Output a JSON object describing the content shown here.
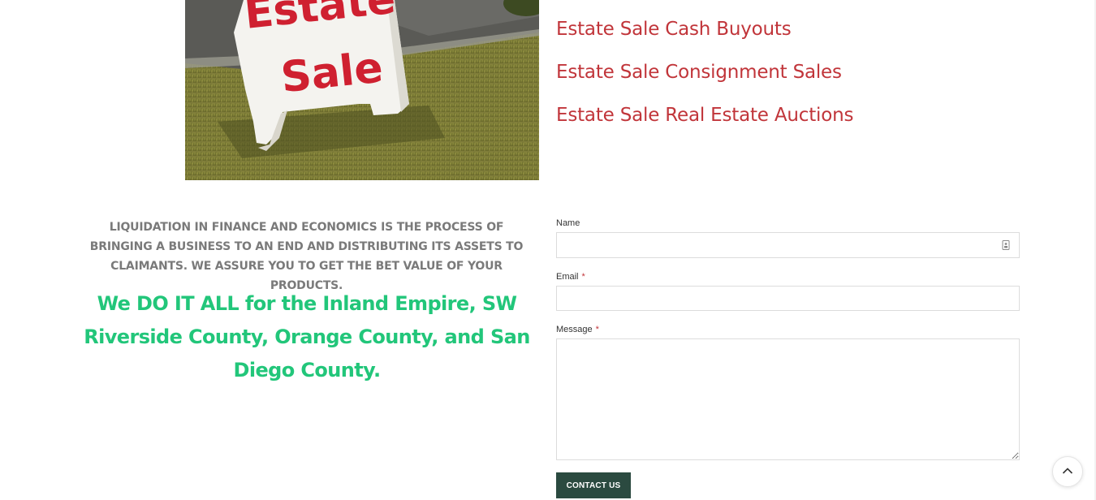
{
  "hero_image": {
    "sign_line1": "Estate",
    "sign_line2": "Sale"
  },
  "services": [
    "Estate Sale Cash Buyouts",
    "Estate Sale Consignment Sales",
    "Estate Sale Real Estate Auctions"
  ],
  "intro_text": "LIQUIDATION IN FINANCE AND ECONOMICS IS THE PROCESS OF BRINGING A BUSINESS TO AN END AND DISTRIBUTING ITS ASSETS TO CLAIMANTS. WE ASSURE YOU TO GET THE BET VALUE OF YOUR PRODUCTS.",
  "tagline": "We DO IT ALL for the Inland Empire, SW Riverside County, Orange County, and San Diego County.",
  "form": {
    "name_label": "Name",
    "name_value": "",
    "email_label": "Email",
    "email_value": "",
    "message_label": "Message",
    "message_value": "",
    "required_mark": "*",
    "submit_label": "CONTACT US"
  },
  "icons": {
    "name_field": "contact-card-icon",
    "scroll_top": "chevron-up-icon",
    "textarea_grip": "resize-grip-icon"
  },
  "colors": {
    "service_links": "#c1353a",
    "tagline": "#22c67a",
    "intro": "#7a7a7a",
    "submit_bg": "#2b4a40",
    "required": "#c1353a"
  }
}
